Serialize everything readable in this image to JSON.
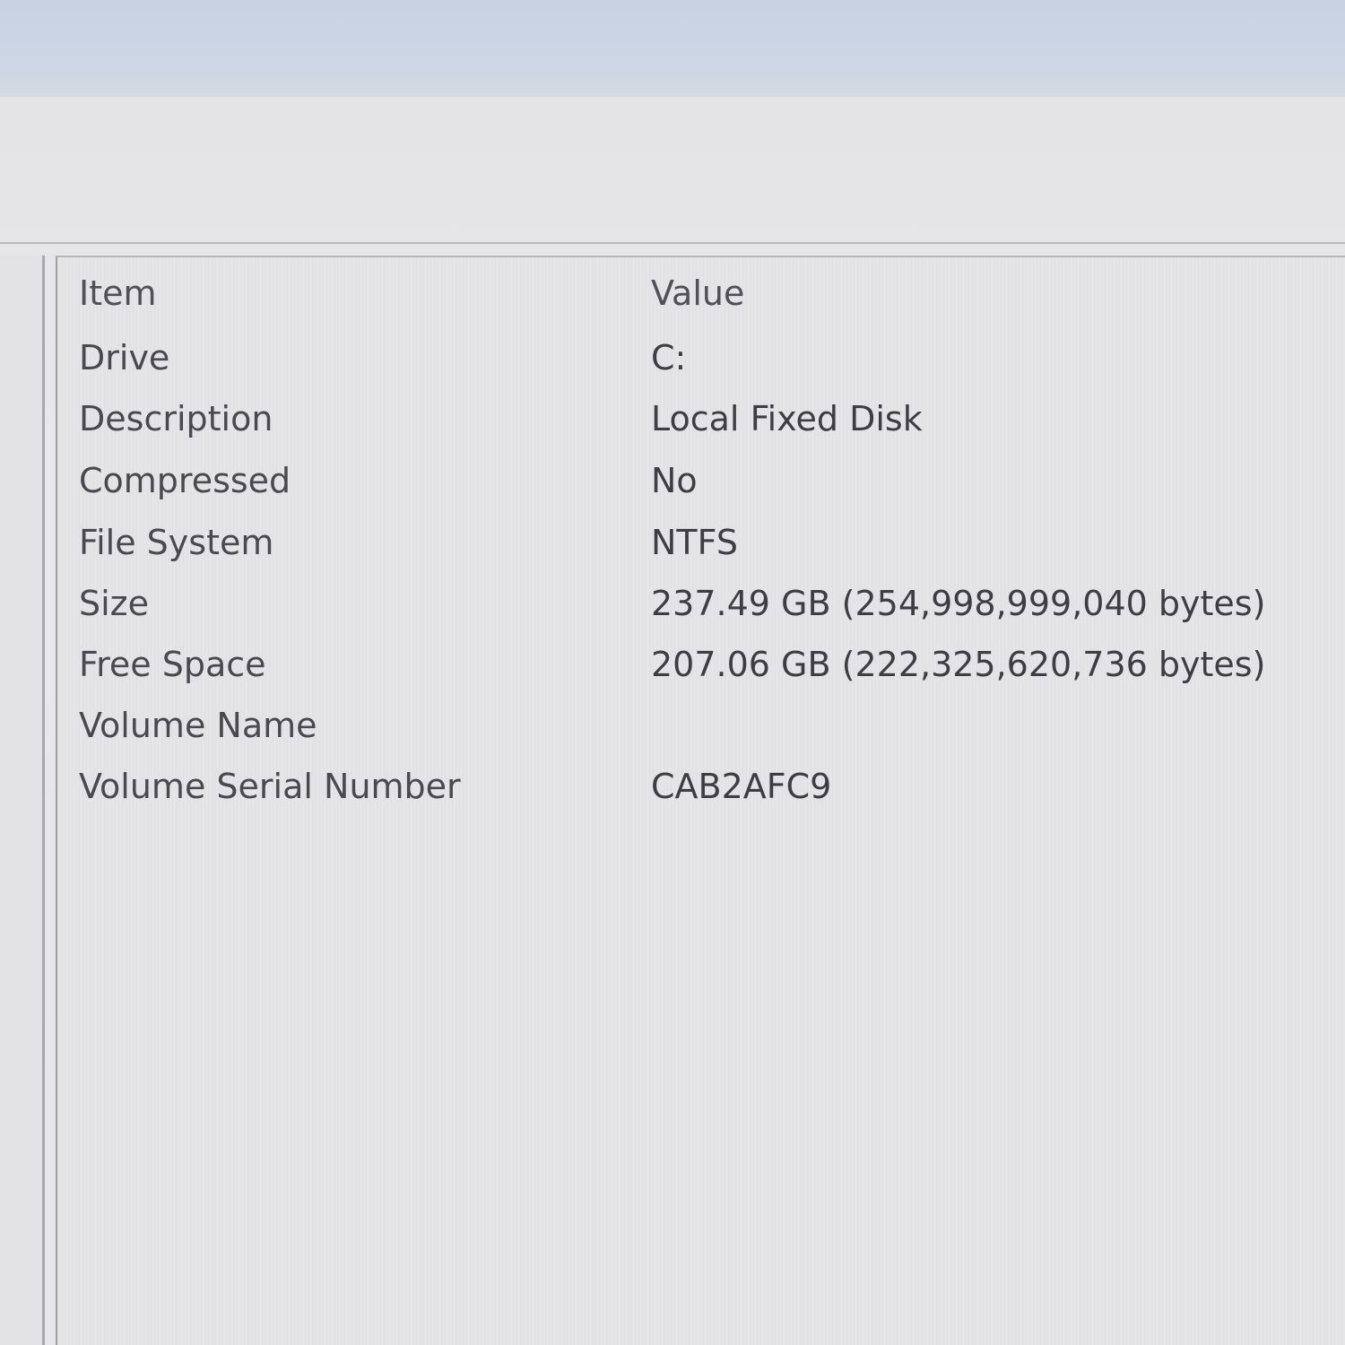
{
  "list": {
    "columns": {
      "item": "Item",
      "value": "Value"
    },
    "rows": [
      {
        "item": "Drive",
        "value": "C:"
      },
      {
        "item": "Description",
        "value": "Local Fixed Disk"
      },
      {
        "item": "Compressed",
        "value": "No"
      },
      {
        "item": "File System",
        "value": "NTFS"
      },
      {
        "item": "Size",
        "value": "237.49 GB (254,998,999,040 bytes)"
      },
      {
        "item": "Free Space",
        "value": "207.06 GB (222,325,620,736 bytes)"
      },
      {
        "item": "Volume Name",
        "value": ""
      },
      {
        "item": "Volume Serial Number",
        "value": "CAB2AFC9"
      }
    ]
  }
}
